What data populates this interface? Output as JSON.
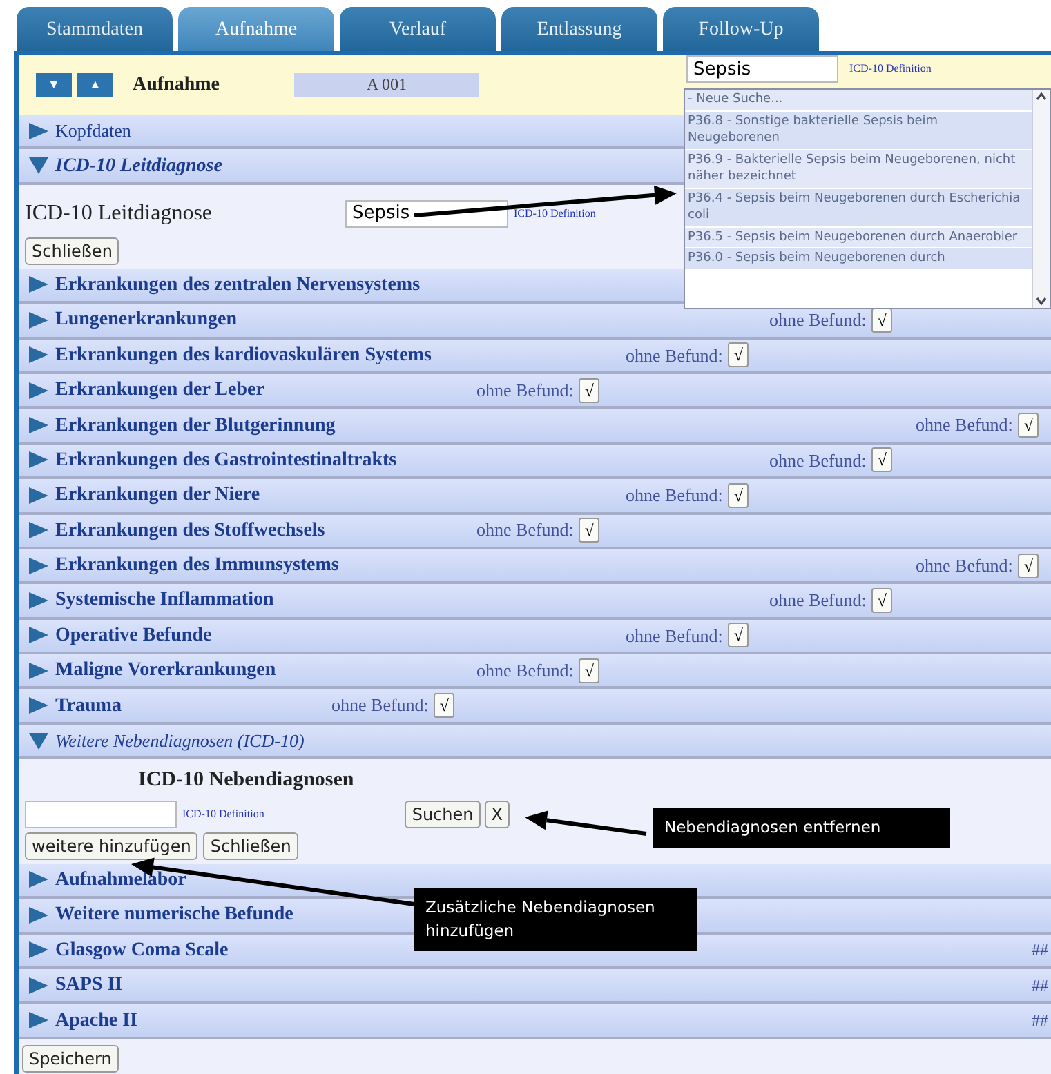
{
  "tabs": [
    {
      "label": "Stammdaten",
      "selected": false
    },
    {
      "label": "Aufnahme",
      "selected": true
    },
    {
      "label": "Verlauf",
      "selected": false
    },
    {
      "label": "Entlassung",
      "selected": false
    },
    {
      "label": "Follow-Up",
      "selected": false
    }
  ],
  "header": {
    "nav_buttons": [
      "▼",
      "▲"
    ],
    "title": "Aufnahme",
    "case_id": "A 001"
  },
  "sections": [
    {
      "title": "Kopfdaten",
      "kind": "group",
      "expanded": false
    },
    {
      "title": "ICD-10 Leitdiagnose",
      "kind": "category",
      "expanded": true,
      "content": {
        "kind": "primary",
        "label": "ICD-10 Leitdiagnose",
        "value": "Sepsis",
        "link": "ICD-10 Definition",
        "buttons": [
          "Schließen"
        ]
      }
    },
    {
      "title": "Erkrankungen des zentralen Nervensystems",
      "kind": "category",
      "expanded": false
    },
    {
      "title": "Lungenerkrankungen",
      "kind": "category",
      "expanded": false,
      "finding": {
        "label": "ohne Befund:",
        "button": "√"
      }
    },
    {
      "title": "Erkrankungen des kardiovaskulären Systems",
      "kind": "category",
      "expanded": false,
      "finding": {
        "label": "ohne Befund:",
        "button": "√"
      }
    },
    {
      "title": "Erkrankungen der Leber",
      "kind": "category",
      "expanded": false,
      "finding": {
        "label": "ohne Befund:",
        "button": "√"
      }
    },
    {
      "title": "Erkrankungen der Blutgerinnung",
      "kind": "category",
      "expanded": false,
      "finding": {
        "label": "ohne Befund:",
        "button": "√"
      }
    },
    {
      "title": "Erkrankungen des Gastrointestinaltrakts",
      "kind": "category",
      "expanded": false,
      "finding": {
        "label": "ohne Befund:",
        "button": "√"
      }
    },
    {
      "title": "Erkrankungen der Niere",
      "kind": "category",
      "expanded": false,
      "finding": {
        "label": "ohne Befund:",
        "button": "√"
      }
    },
    {
      "title": "Erkrankungen des Stoffwechsels",
      "kind": "category",
      "expanded": false,
      "finding": {
        "label": "ohne Befund:",
        "button": "√"
      }
    },
    {
      "title": "Erkrankungen des Immunsystems",
      "kind": "category",
      "expanded": false,
      "finding": {
        "label": "ohne Befund:",
        "button": "√"
      }
    },
    {
      "title": "Systemische Inflammation",
      "kind": "category",
      "expanded": false,
      "finding": {
        "label": "ohne Befund:",
        "button": "√"
      }
    },
    {
      "title": "Operative Befunde",
      "kind": "category",
      "expanded": false,
      "finding": {
        "label": "ohne Befund:",
        "button": "√"
      }
    },
    {
      "title": "Maligne Vorerkrankungen",
      "kind": "category",
      "expanded": false,
      "finding": {
        "label": "ohne Befund:",
        "button": "√"
      }
    },
    {
      "title": "Trauma",
      "kind": "category",
      "expanded": false,
      "finding": {
        "label": "ohne Befund:",
        "button": "√"
      }
    },
    {
      "title": "Weitere Nebendiagnosen (ICD-10)",
      "kind": "group",
      "expanded": true,
      "content": {
        "kind": "secondary",
        "heading": "ICD-10 Nebendiagnosen",
        "link": "ICD-10 Definition",
        "search_button": "Suchen",
        "remove_button": "X",
        "buttons": [
          "weitere hinzufügen",
          "Schließen"
        ]
      }
    },
    {
      "title": "Aufnahmelabor",
      "kind": "category",
      "expanded": false
    },
    {
      "title": "Weitere numerische Befunde",
      "kind": "category",
      "expanded": false
    },
    {
      "title": "Glasgow Coma Scale",
      "kind": "category",
      "expanded": false,
      "score": "##"
    },
    {
      "title": "SAPS II",
      "kind": "category",
      "expanded": false,
      "score": "##"
    },
    {
      "title": "Apache II",
      "kind": "category",
      "expanded": false,
      "score": "##"
    }
  ],
  "save_button": "Speichern",
  "autocomplete": {
    "value": "Sepsis",
    "link": "ICD-10 Definition",
    "options": [
      {
        "label": "- Neue Suche..."
      },
      {
        "label": "P36.8 - Sonstige bakterielle Sepsis beim Neugeborenen"
      },
      {
        "label": "P36.9 - Bakterielle Sepsis beim Neugeborenen, nicht näher bezeichnet"
      },
      {
        "label": "P36.4 - Sepsis beim Neugeborenen durch Escherichia coli"
      },
      {
        "label": "P36.5 - Sepsis beim Neugeborenen durch Anaerobier"
      },
      {
        "label": "P36.0 - Sepsis beim Neugeborenen durch"
      }
    ]
  },
  "callouts": [
    {
      "text": "Nebendiagnosen entfernen"
    },
    {
      "text": "Zusätzliche Nebendiagnosen hinzufügen"
    }
  ]
}
